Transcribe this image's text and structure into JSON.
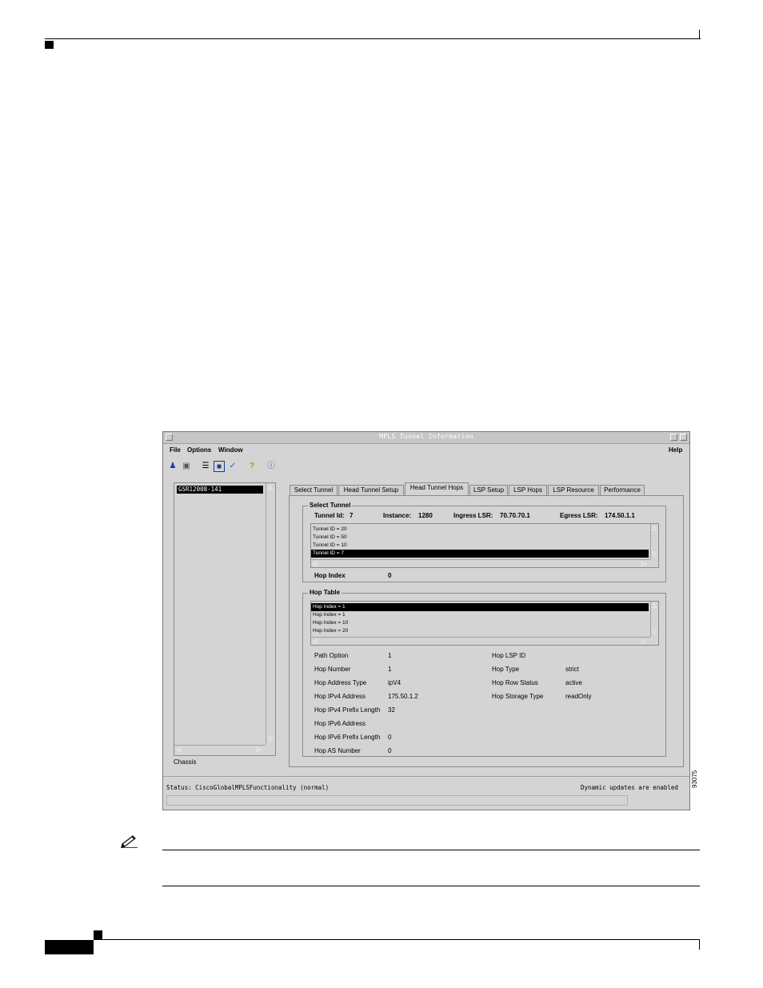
{
  "window": {
    "title": "MPLS Tunnel Information",
    "menus": [
      "File",
      "Options",
      "Window"
    ],
    "help_menu": "Help"
  },
  "left_panel": {
    "selected_item": "GSR12008-141",
    "label": "Chassis"
  },
  "tabs": [
    "Select Tunnel",
    "Head Tunnel Setup",
    "Head Tunnel Hops",
    "LSP Setup",
    "LSP Hops",
    "LSP Resource",
    "Performance"
  ],
  "active_tab": "Head Tunnel Hops",
  "select_tunnel": {
    "group_title": "Select Tunnel",
    "tunnel_id_label": "Tunnel Id:",
    "tunnel_id": "7",
    "instance_label": "Instance:",
    "instance": "1280",
    "ingress_label": "Ingress LSR:",
    "ingress": "70.70.70.1",
    "egress_label": "Egress LSR:",
    "egress": "174.50.1.1",
    "list": [
      "Tunnel ID = 20",
      "Tunnel ID = 50",
      "Tunnel ID = 10",
      "Tunnel ID = 7"
    ],
    "hop_index_label": "Hop Index",
    "hop_index": "0"
  },
  "hop_table": {
    "group_title": "Hop Table",
    "list": [
      "Hop Index = 1",
      "Hop Index = 1",
      "Hop Index = 10",
      "Hop Index = 20"
    ],
    "left_fields": [
      {
        "label": "Path Option",
        "value": "1"
      },
      {
        "label": "Hop Number",
        "value": "1"
      },
      {
        "label": "Hop Address Type",
        "value": "ipV4"
      },
      {
        "label": "Hop IPv4 Address",
        "value": "175.50.1.2"
      },
      {
        "label": "Hop IPv4 Prefix Length",
        "value": "32"
      },
      {
        "label": "Hop IPv6 Address",
        "value": ""
      },
      {
        "label": "Hop IPv6 Prefix Length",
        "value": "0"
      },
      {
        "label": "Hop AS Number",
        "value": "0"
      }
    ],
    "right_fields": [
      {
        "label": "Hop LSP ID",
        "value": ""
      },
      {
        "label": "Hop Type",
        "value": "strict"
      },
      {
        "label": "Hop Row Status",
        "value": "active"
      },
      {
        "label": "Hop Storage Type",
        "value": "readOnly"
      }
    ]
  },
  "status": {
    "left": "Status: CiscoGlobalMPLSFunctionality (normal)",
    "right": "Dynamic updates are enabled"
  },
  "figure_id": "93075",
  "icons": [
    "people-icon",
    "devices-icon",
    "list-icon",
    "monitor-icon",
    "check-icon",
    "help-icon",
    "info-icon",
    "note-pencil-icon"
  ]
}
